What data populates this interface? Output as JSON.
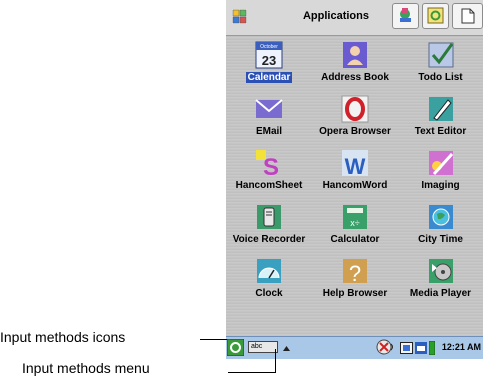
{
  "header": {
    "title": "Applications"
  },
  "apps": [
    {
      "label": "Calendar",
      "icon": "calendar-icon"
    },
    {
      "label": "Address Book",
      "icon": "address-book-icon"
    },
    {
      "label": "Todo List",
      "icon": "todo-list-icon"
    },
    {
      "label": "EMail",
      "icon": "email-icon"
    },
    {
      "label": "Opera Browser",
      "icon": "opera-browser-icon"
    },
    {
      "label": "Text Editor",
      "icon": "text-editor-icon"
    },
    {
      "label": "HancomSheet",
      "icon": "hancomsheet-icon"
    },
    {
      "label": "HancomWord",
      "icon": "hancomword-icon"
    },
    {
      "label": "Imaging",
      "icon": "imaging-icon"
    },
    {
      "label": "Voice Recorder",
      "icon": "voice-recorder-icon"
    },
    {
      "label": "Calculator",
      "icon": "calculator-icon"
    },
    {
      "label": "City Time",
      "icon": "city-time-icon"
    },
    {
      "label": "Clock",
      "icon": "clock-icon"
    },
    {
      "label": "Help Browser",
      "icon": "help-browser-icon"
    },
    {
      "label": "Media Player",
      "icon": "media-player-icon"
    }
  ],
  "calendar_icon_text": {
    "month": "October",
    "day": "23"
  },
  "statusbar": {
    "input_method_text": "abc",
    "time": "12:21 AM"
  },
  "annotations": {
    "input_methods_icons": "Input methods icons",
    "input_methods_menu": "Input methods menu"
  },
  "colors": {
    "selection": "#2a4fb5",
    "statusbar": "#a9c7e6"
  }
}
